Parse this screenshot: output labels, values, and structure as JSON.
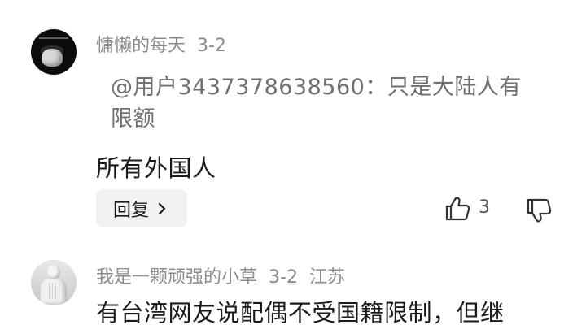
{
  "comments": [
    {
      "username": "慵懒的每天",
      "date": "3-2",
      "quote_line1": "@用户3437378638560：只是大陆人有",
      "quote_line2": "限额",
      "text": "所有外国人",
      "reply_label": "回复",
      "like_count": "3"
    },
    {
      "username": "我是一颗顽强的小草",
      "date": "3-2",
      "location": "江苏",
      "text": "有台湾网友说配偶不受国籍限制，但继"
    }
  ],
  "icons": {
    "reply_chevron": "chevron-right-icon",
    "like": "thumbs-up-icon",
    "dislike": "thumbs-down-icon"
  },
  "colors": {
    "username": "#8c8c8c",
    "quote": "#6f6f6f",
    "text": "#1a1a1a",
    "reply_bg": "#f2f2f2"
  }
}
